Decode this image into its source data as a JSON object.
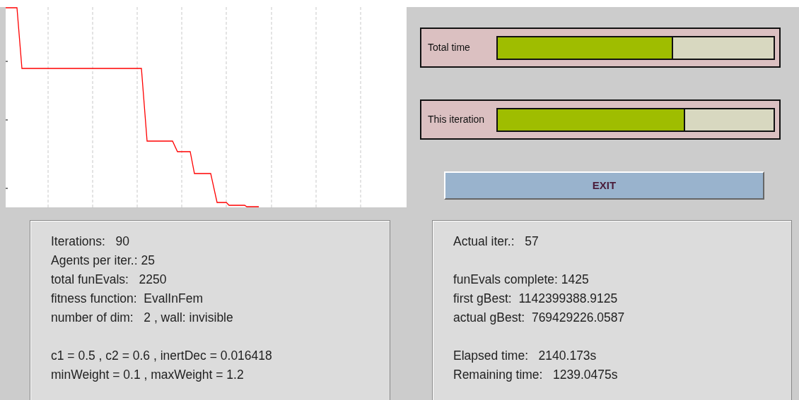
{
  "progress_bars": [
    {
      "label": "Total time",
      "level": 0.635
    },
    {
      "label": "This iteration",
      "level": 0.68
    }
  ],
  "exit_button": {
    "label": "EXIT"
  },
  "settings_panel": {
    "groups": [
      [
        "Iterations:   90",
        "Agents per iter.: 25",
        "total funEvals:   2250",
        "fitness function:  EvalInFem",
        "number of dim:   2 , wall: invisible"
      ],
      [
        "c1 = 0.5 , c2 = 0.6 , inertDec = 0.016418",
        "minWeight = 0.1 , maxWeight = 1.2"
      ]
    ]
  },
  "status_panel": {
    "groups": [
      [
        "Actual iter.:   57"
      ],
      [
        "funEvals complete: 1425",
        "first gBest:  1142399388.9125",
        "actual gBest:  769429226.0587"
      ],
      [
        "Elapsed time:   2140.173s",
        "Remaining time:   1239.0475s"
      ]
    ]
  }
}
